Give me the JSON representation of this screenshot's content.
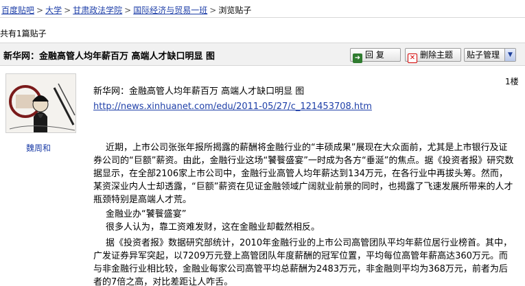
{
  "breadcrumb": {
    "items": [
      {
        "label": "百度贴吧"
      },
      {
        "label": "大学"
      },
      {
        "label": "甘肃政法学院"
      },
      {
        "label": "国际经济与贸易一班"
      }
    ],
    "separator": ">",
    "current": "浏览贴子"
  },
  "thread": {
    "count_text": "共有1篇贴子",
    "title": "新华网：金融高管人均年薪百万 高端人才缺口明显 图",
    "reply_label": "回 复",
    "delete_label": "删除主题",
    "manage_label": "贴子管理"
  },
  "post": {
    "floor": "1楼",
    "author": "魏周和",
    "headline": "新华网：金融高管人均年薪百万 高端人才缺口明显 图",
    "link": "http://news.xinhuanet.com/edu/2011-05/27/c_121453708.htm",
    "paragraphs": [
      "近期，上市公司张张年报所揭露的薪酬将金融行业的“丰硕成果”展现在大众面前，尤其是上市银行及证券公司的“巨额”薪资。由此，金融行业这场“饕餮盛宴”一时成为各方“垂涎”的焦点。据《投资者报》研究数据显示，在全部2106家上市公司中，金融行业高管人均年薪达到134万元，在各行业中再拔头筹。然而，某资深业内人士却透露，“巨额”薪资在见证金融领域广阔就业前景的同时，也揭露了飞速发展所带来的人才瓶颈特别是高端人才荒。",
      "金融业办“饕餮盛宴”",
      "很多人认为，靠工资难发财，这在金融业却截然相反。",
      "据《投资者报》数据研究部统计，2010年金融行业的上市公司高管团队平均年薪位居行业榜首。其中，广发证券异军突起，以7209万元登上高管团队年度薪酬的冠军位置，平均每位高管年薪高达360万元。而与非金融行业相比较，金融业每家公司高管平均总薪酬为2483万元，非金融则平均为368万元，前者为后者的7倍之高，对比差距让人咋舌。"
    ]
  },
  "colors": {
    "link": "#1e3fa8",
    "title_bar": "#f1f1f1",
    "delete_icon": "#d40000",
    "reply_icon": "#2f7b2f"
  }
}
